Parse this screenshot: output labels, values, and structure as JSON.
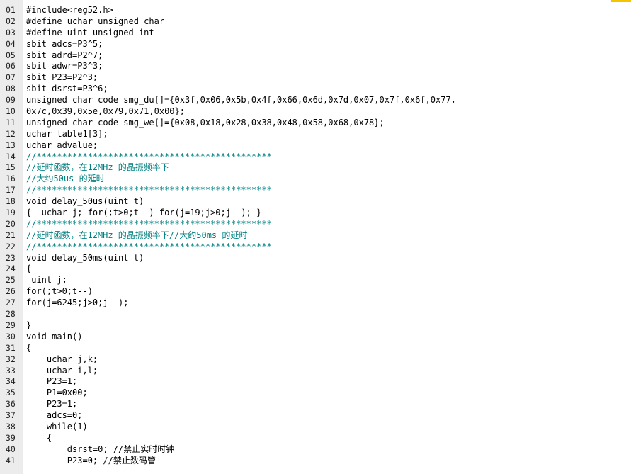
{
  "editor": {
    "accent_color": "#f5c400",
    "comment_color": "#008080",
    "lines": [
      {
        "n": "01",
        "t": "#include<reg52.h>",
        "k": "code"
      },
      {
        "n": "02",
        "t": "#define uchar unsigned char",
        "k": "code"
      },
      {
        "n": "03",
        "t": "#define uint unsigned int",
        "k": "code"
      },
      {
        "n": "04",
        "t": "sbit adcs=P3^5;",
        "k": "code"
      },
      {
        "n": "05",
        "t": "sbit adrd=P2^7;",
        "k": "code"
      },
      {
        "n": "06",
        "t": "sbit adwr=P3^3;",
        "k": "code"
      },
      {
        "n": "07",
        "t": "sbit P23=P2^3;",
        "k": "code"
      },
      {
        "n": "08",
        "t": "sbit dsrst=P3^6;",
        "k": "code"
      },
      {
        "n": "09",
        "t": "unsigned char code smg_du[]={0x3f,0x06,0x5b,0x4f,0x66,0x6d,0x7d,0x07,0x7f,0x6f,0x77,",
        "k": "code"
      },
      {
        "n": "10",
        "t": "0x7c,0x39,0x5e,0x79,0x71,0x00};",
        "k": "code"
      },
      {
        "n": "11",
        "t": "unsigned char code smg_we[]={0x08,0x18,0x28,0x38,0x48,0x58,0x68,0x78};",
        "k": "code"
      },
      {
        "n": "12",
        "t": "uchar table1[3];",
        "k": "code"
      },
      {
        "n": "13",
        "t": "uchar advalue;",
        "k": "code"
      },
      {
        "n": "14",
        "t": "//**********************************************",
        "k": "cmt"
      },
      {
        "n": "15",
        "t": "//延时函数，在12MHz 的晶振频率下",
        "k": "cmt"
      },
      {
        "n": "16",
        "t": "//大约50us 的延时",
        "k": "cmt"
      },
      {
        "n": "17",
        "t": "//**********************************************",
        "k": "cmt"
      },
      {
        "n": "18",
        "t": "void delay_50us(uint t)",
        "k": "code"
      },
      {
        "n": "19",
        "t": "{  uchar j; for(;t>0;t--) for(j=19;j>0;j--); }",
        "k": "code"
      },
      {
        "n": "20",
        "t": "//**********************************************",
        "k": "cmt"
      },
      {
        "n": "21",
        "t": "//延时函数，在12MHz 的晶振频率下//大约50ms 的延时",
        "k": "cmt"
      },
      {
        "n": "22",
        "t": "//**********************************************",
        "k": "cmt"
      },
      {
        "n": "23",
        "t": "void delay_50ms(uint t)",
        "k": "code"
      },
      {
        "n": "24",
        "t": "{",
        "k": "code"
      },
      {
        "n": "25",
        "t": " uint j;",
        "k": "code"
      },
      {
        "n": "26",
        "t": "for(;t>0;t--)",
        "k": "code"
      },
      {
        "n": "27",
        "t": "for(j=6245;j>0;j--);",
        "k": "code"
      },
      {
        "n": "28",
        "t": "",
        "k": "code"
      },
      {
        "n": "29",
        "t": "}",
        "k": "code"
      },
      {
        "n": "30",
        "t": "void main()",
        "k": "code"
      },
      {
        "n": "31",
        "t": "{",
        "k": "code"
      },
      {
        "n": "32",
        "t": "    uchar j,k;",
        "k": "code"
      },
      {
        "n": "33",
        "t": "    uchar i,l;",
        "k": "code"
      },
      {
        "n": "34",
        "t": "    P23=1;",
        "k": "code"
      },
      {
        "n": "35",
        "t": "    P1=0x00;",
        "k": "code"
      },
      {
        "n": "36",
        "t": "    P23=1;",
        "k": "code"
      },
      {
        "n": "37",
        "t": "    adcs=0;",
        "k": "code"
      },
      {
        "n": "38",
        "t": "    while(1)",
        "k": "code"
      },
      {
        "n": "39",
        "t": "    {",
        "k": "code"
      },
      {
        "n": "40",
        "t": "        dsrst=0; //禁止实时时钟",
        "k": "code"
      },
      {
        "n": "41",
        "t": "        P23=0; //禁止数码管",
        "k": "code"
      }
    ]
  }
}
